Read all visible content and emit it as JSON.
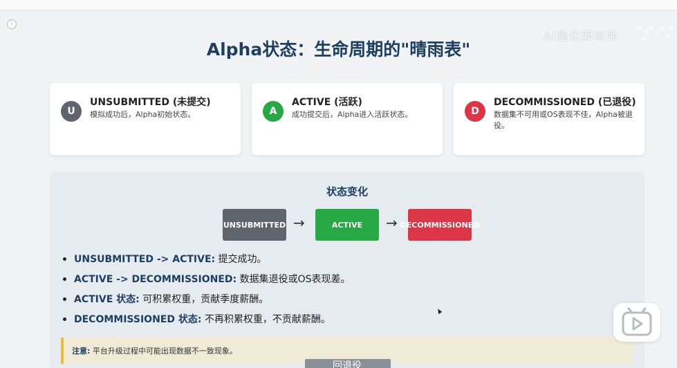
{
  "watermark": "AI量化郭老师",
  "title": "Alpha状态：生命周期的\"晴雨表\"",
  "cards": [
    {
      "badge": "U",
      "title": "UNSUBMITTED (未提交)",
      "desc": "模拟成功后，Alpha初始状态。",
      "color": "#5f656e"
    },
    {
      "badge": "A",
      "title": "ACTIVE (活跃)",
      "desc": "成功提交后，Alpha进入活跃状态。",
      "color": "#28a745"
    },
    {
      "badge": "D",
      "title": "DECOMMISSIONED (已退役)",
      "desc": "数据集不可用或OS表现不佳，Alpha被退役。",
      "color": "#dc3545"
    }
  ],
  "panel": {
    "title": "状态变化",
    "states": [
      {
        "label": "UNSUBMITTED",
        "color": "#5f656e"
      },
      {
        "label": "ACTIVE",
        "color": "#28a745"
      },
      {
        "label": "DECOMMISSIONED",
        "color": "#dc3545"
      }
    ],
    "arrow": "→",
    "transitions": [
      {
        "key": "UNSUBMITTED -> ACTIVE:",
        "text": " 提交成功。"
      },
      {
        "key": "ACTIVE -> DECOMMISSIONED:",
        "text": " 数据集退役或OS表现差。"
      },
      {
        "key": "ACTIVE 状态:",
        "text": " 可积累权重，贡献季度薪酬。"
      },
      {
        "key": "DECOMMISSIONED 状态:",
        "text": " 不再积累权重，不贡献薪酬。"
      }
    ],
    "notice_label": "注意:",
    "notice_text": " 平台升级过程中可能出现数据不一致现象。"
  },
  "bottom_button": "回退役",
  "icons": {
    "info": "info-icon",
    "play": "play-icon",
    "cursor": "cursor-icon"
  }
}
